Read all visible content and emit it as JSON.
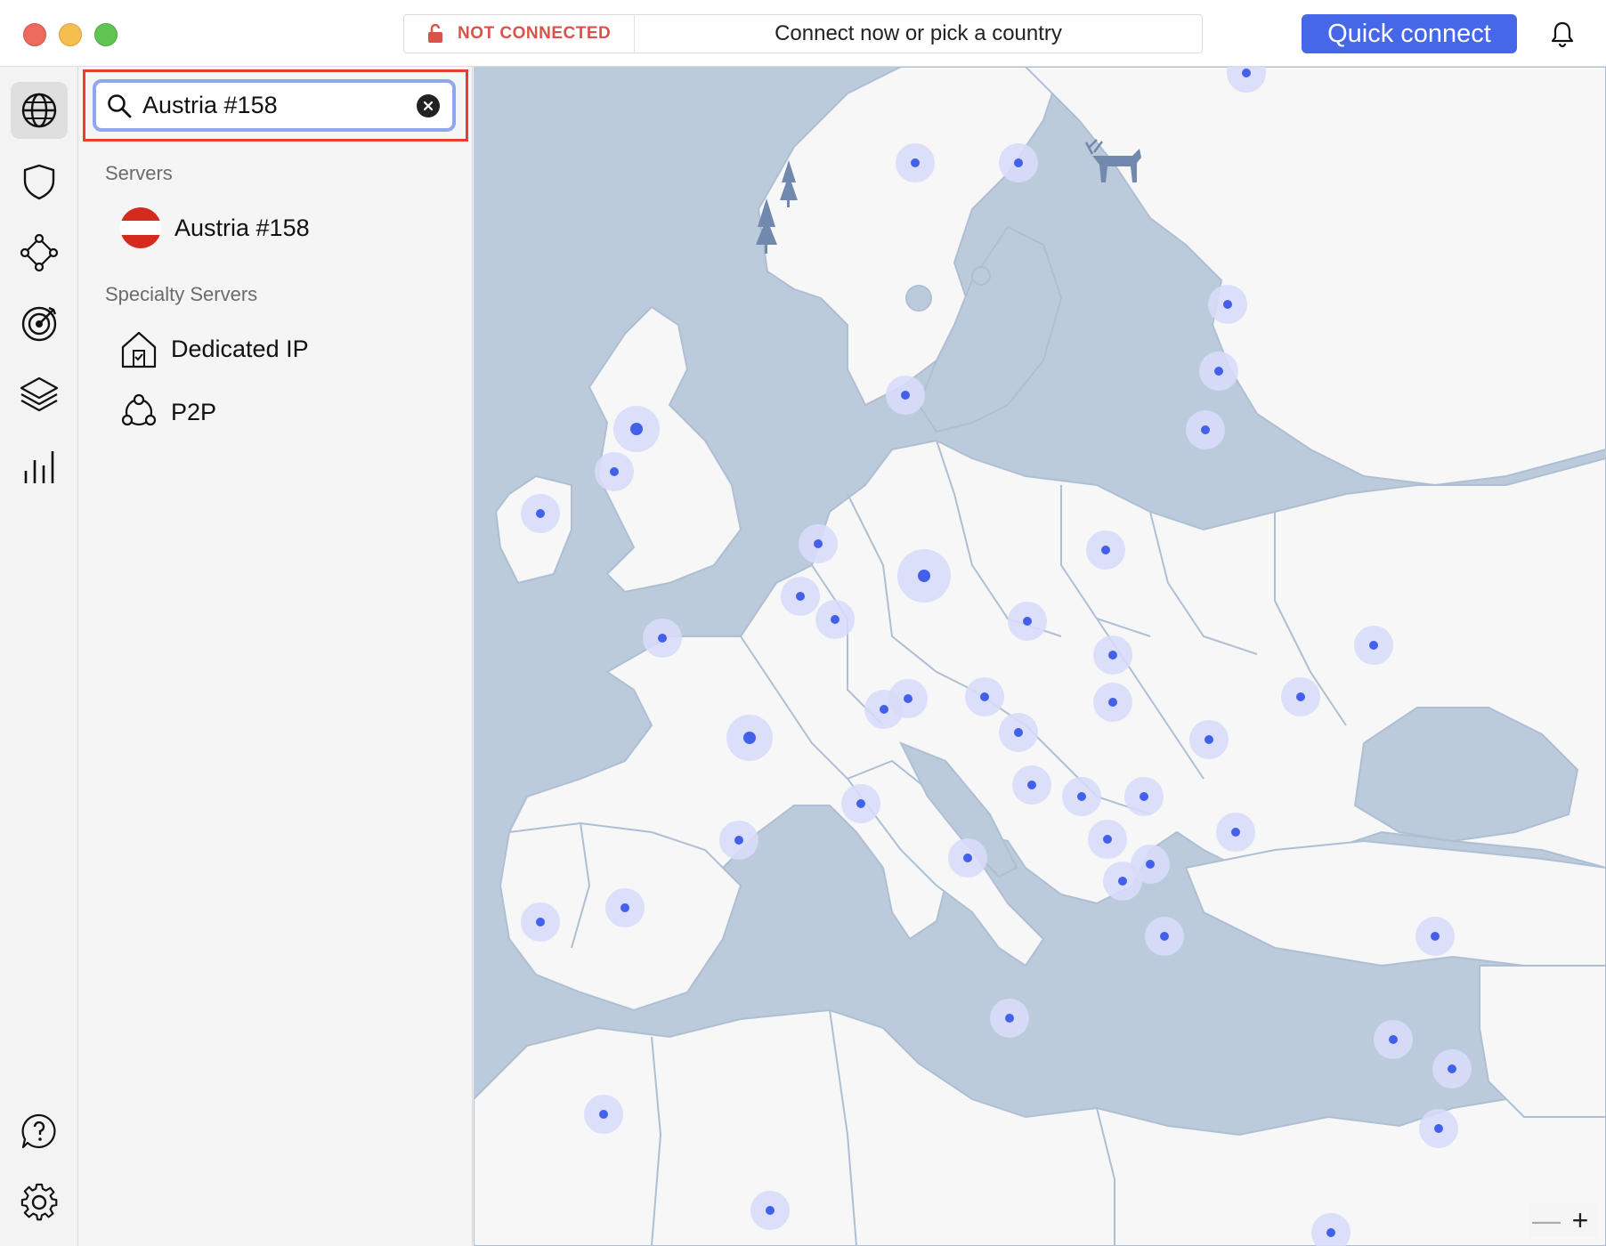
{
  "header": {
    "status_text": "NOT CONNECTED",
    "hint_text": "Connect now or pick a country",
    "quick_connect_label": "Quick connect"
  },
  "search": {
    "value": "Austria #158"
  },
  "sections": {
    "servers_label": "Servers",
    "specialty_label": "Specialty Servers"
  },
  "servers": [
    {
      "label": "Austria #158",
      "flag": "austria-flag"
    }
  ],
  "specialty": [
    {
      "label": "Dedicated IP",
      "icon": "house-icon"
    },
    {
      "label": "P2P",
      "icon": "p2p-icon"
    }
  ],
  "rail": [
    "globe-icon",
    "shield-icon",
    "meshnet-icon",
    "target-icon",
    "layers-icon",
    "stats-icon",
    "help-icon",
    "settings-icon"
  ],
  "map": {
    "zoom_out": "—",
    "zoom_in": "+"
  },
  "colors": {
    "accent": "#4667e8",
    "status_red": "#d9534a",
    "highlight": "#e5402f",
    "water": "#bccbdc",
    "land": "#f7f7f7",
    "marker": "#4360ea"
  }
}
